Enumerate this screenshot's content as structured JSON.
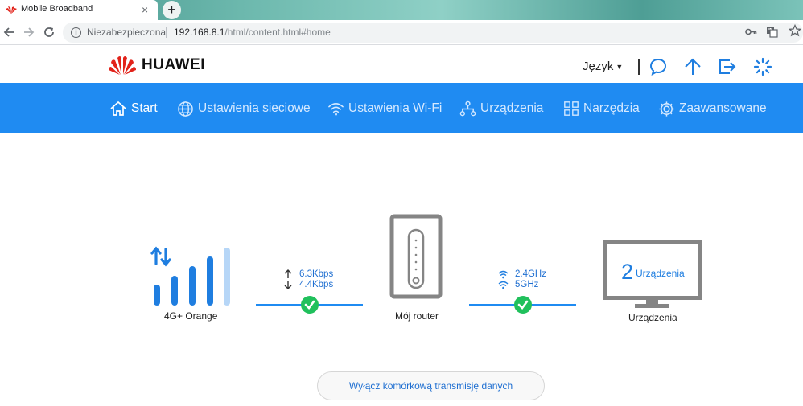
{
  "browser": {
    "tab_title": "Mobile Broadband",
    "tab_close": "×",
    "new_tab": "+",
    "security_label": "Niezabezpieczona",
    "url_host": "192.168.8.1",
    "url_path": "/html/content.html#home",
    "info_glyph": "i"
  },
  "header": {
    "brand": "HUAWEI",
    "language_label": "Język",
    "icons": [
      "message-icon",
      "update-icon",
      "logout-icon",
      "loading-icon"
    ]
  },
  "nav": {
    "items": [
      {
        "label": "Start",
        "icon": "home-icon",
        "active": true
      },
      {
        "label": "Ustawienia sieciowe",
        "icon": "globe-icon"
      },
      {
        "label": "Ustawienia Wi-Fi",
        "icon": "wifi-icon"
      },
      {
        "label": "Urządzenia",
        "icon": "devices-icon"
      },
      {
        "label": "Narzędzia",
        "icon": "tools-icon"
      },
      {
        "label": "Zaawansowane",
        "icon": "gear-icon"
      }
    ]
  },
  "status": {
    "network_name": "4G+ Orange",
    "upload_rate": "6.3Kbps",
    "download_rate": "4.4Kbps",
    "router_label": "Mój router",
    "wifi_band_1": "2.4GHz",
    "wifi_band_2": "5GHz",
    "device_count": "2",
    "device_count_label": "Urządzenia",
    "devices_label": "Urządzenia"
  },
  "actions": {
    "disable_data_label": "Wyłącz komórkową transmisję danych"
  },
  "colors": {
    "accent": "#1f8bf2",
    "check": "#20c05c",
    "brand_red": "#e2231a"
  }
}
